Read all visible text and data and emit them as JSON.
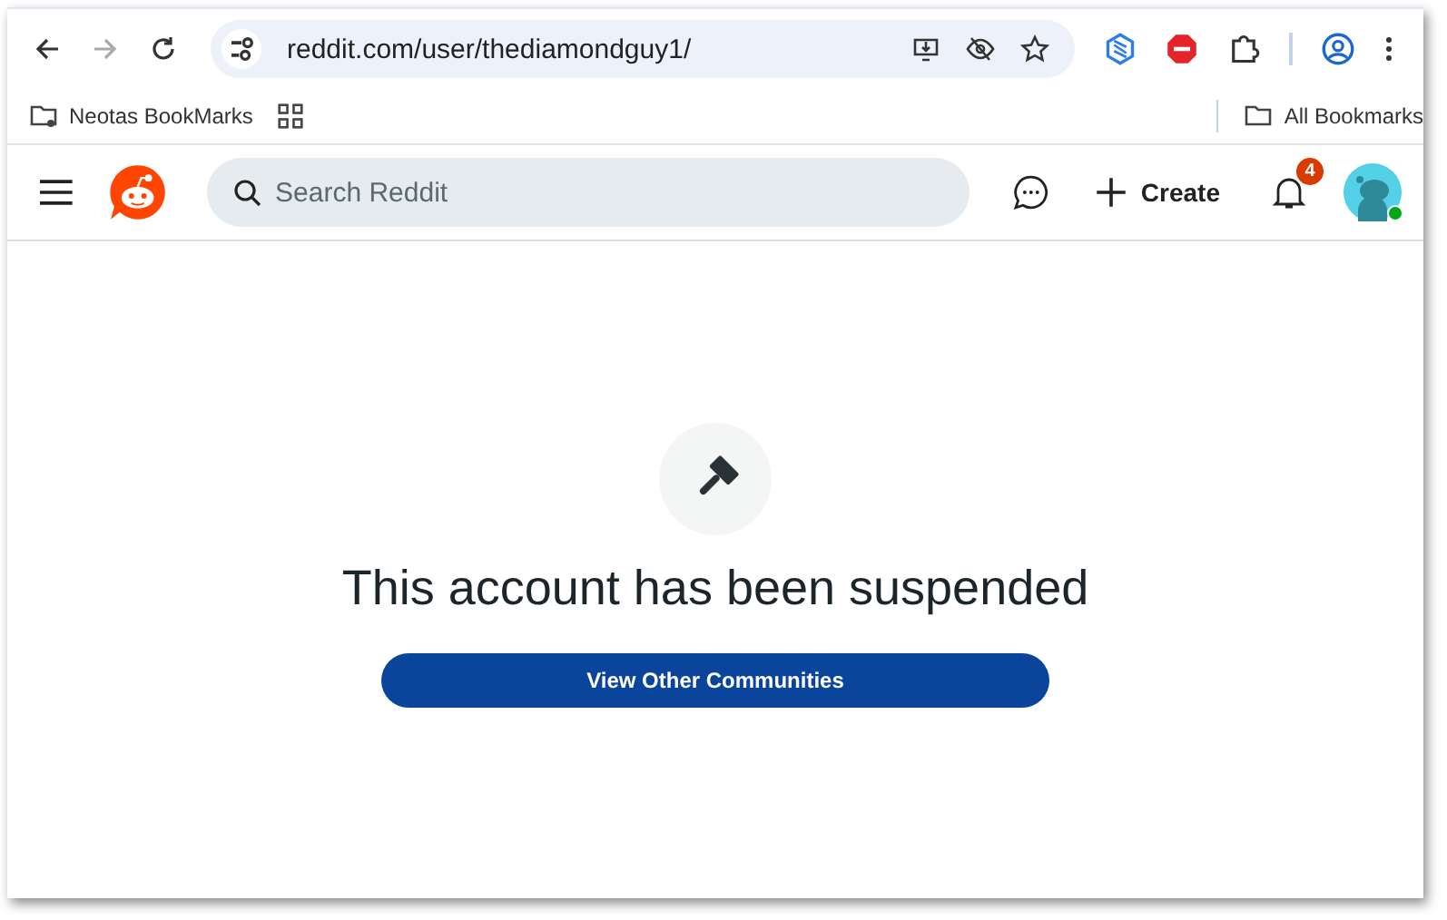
{
  "browser": {
    "nav": [
      {
        "kind": "back",
        "disabled": false
      },
      {
        "kind": "forward",
        "disabled": true
      },
      {
        "kind": "reload",
        "disabled": false
      }
    ],
    "url": "reddit.com/user/thediamondguy1/",
    "bookmarks": [
      {
        "label": "Neotas BookMarks"
      }
    ],
    "all_bookmarks": "All Bookmarks"
  },
  "header": {
    "search": {
      "placeholder": "Search Reddit"
    },
    "create": "Create",
    "notifications": "4",
    "avatar": {
      "online": true
    }
  },
  "message": {
    "title": "This account has been suspended",
    "button": "View Other Communities"
  }
}
